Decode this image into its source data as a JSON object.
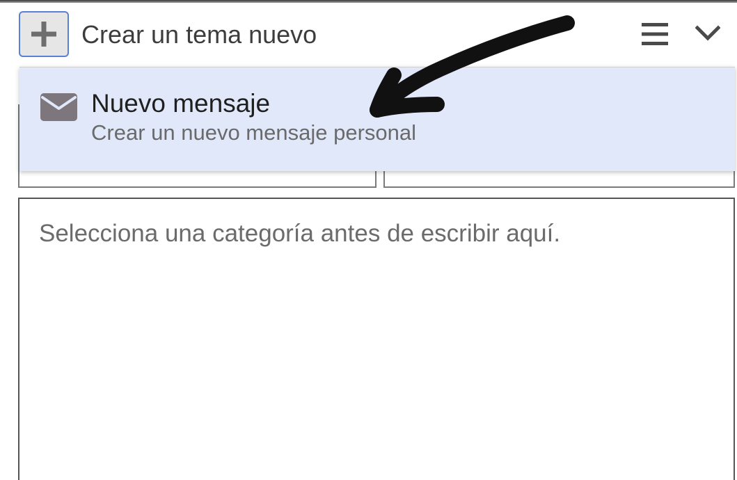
{
  "composer": {
    "title": "Crear un tema nuevo",
    "toggle_icon": "plus-icon",
    "menu_icon": "hamburger-menu-icon",
    "collapse_icon": "chevron-down-icon"
  },
  "dropdown": {
    "items": [
      {
        "icon": "envelope-icon",
        "title": "Nuevo mensaje",
        "description": "Crear un nuevo mensaje personal"
      }
    ]
  },
  "editor": {
    "placeholder": "Selecciona una categoría antes de escribir aquí."
  },
  "colors": {
    "dropdown_highlight": "#e1e8fa",
    "button_focus_border": "#5a7fd6",
    "icon_gray": "#7d767c",
    "annotation": "#111111"
  }
}
